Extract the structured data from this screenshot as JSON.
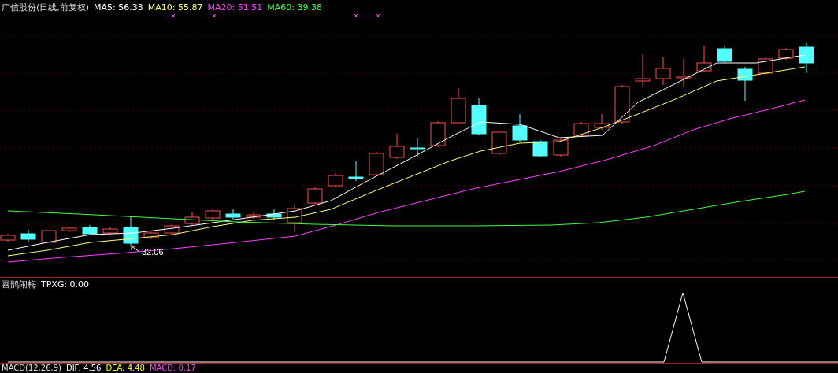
{
  "main_panel": {
    "title": "广信股份(日线,前复权)",
    "indicators": [
      {
        "label": "MA5: 56.33",
        "color": "#ffffff"
      },
      {
        "label": "MA10: 55.87",
        "color": "#ffff80"
      },
      {
        "label": "MA20: 51.51",
        "color": "#ff40ff"
      },
      {
        "label": "MA60: 39.38",
        "color": "#40ff40"
      }
    ],
    "low_label": "32.06"
  },
  "sub_panel": {
    "title": "喜鹊闹梅",
    "indicators": [
      {
        "label": "TPXG: 0.00",
        "color": "#ffffff"
      }
    ]
  },
  "macd_panel": {
    "title": "MACD(12,26,9)",
    "indicators": [
      {
        "label": "DIF: 4.56",
        "color": "#ffffff"
      },
      {
        "label": "DEA: 4.48",
        "color": "#ffff00"
      },
      {
        "label": "MACD: 0.17",
        "color": "#ff40ff"
      }
    ]
  }
}
